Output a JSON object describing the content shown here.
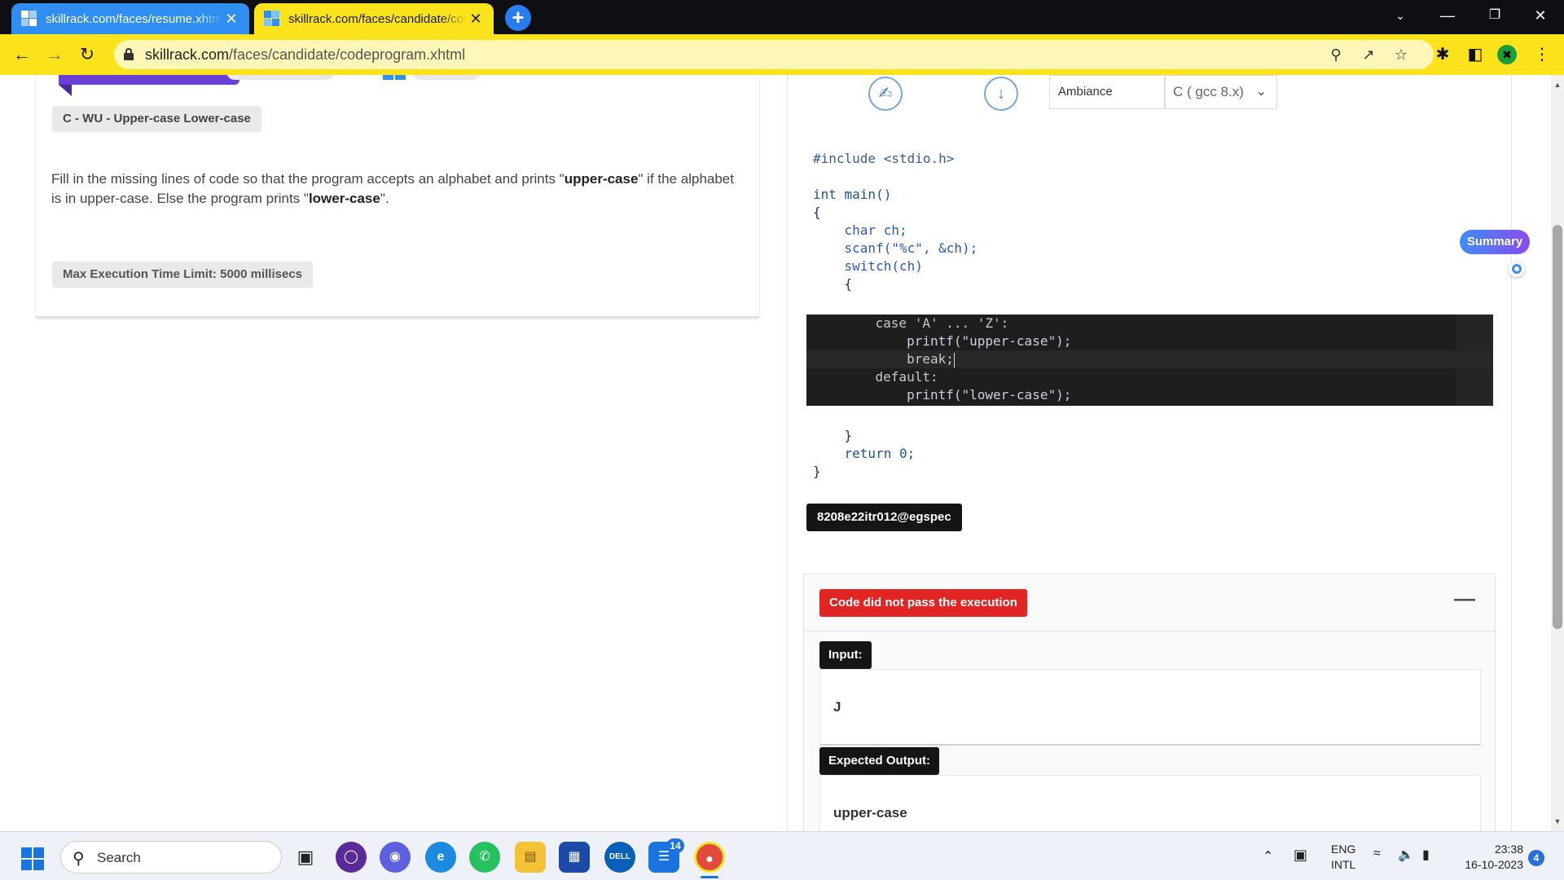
{
  "browser": {
    "tabs": [
      {
        "title": "skillrack.com/faces/resume.xhtml",
        "close": "✕",
        "active": false
      },
      {
        "title": "skillrack.com/faces/candidate/codeprogram.xhtml",
        "close": "✕",
        "active": true
      }
    ],
    "new_tab": "+",
    "url_host": "skillrack.com",
    "url_path": "/faces/candidate/codeprogram.xhtml",
    "colors": {
      "tabbar": "#0d0f12",
      "toolbar": "#fde31c",
      "tab_active": "#fde31c",
      "tab_inactive": "#2f8ef0"
    }
  },
  "problem": {
    "title": "C - WU - Upper-case Lower-case",
    "description_pre": "Fill in the missing lines of code so that the program accepts an alphabet and prints \"",
    "bold1": "upper-case",
    "description_mid": "\" if the alphabet is in upper-case. Else the program prints \"",
    "bold2": "lower-case",
    "description_post": "\".",
    "time_limit": "Max Execution Time Limit: 5000 millisecs"
  },
  "toolbar": {
    "theme_label": "Ambiance",
    "language": "C ( gcc 8.x)"
  },
  "code_before": [
    "#include <stdio.h>",
    "",
    "int main()",
    "{",
    "    char ch;",
    "    scanf(\"%c\", &ch);",
    "    switch(ch)",
    "    {"
  ],
  "editor_lines": [
    "    case 'A' ... 'Z':",
    "        printf(\"upper-case\");",
    "        break;",
    "    default:",
    "        printf(\"lower-case\");"
  ],
  "code_after": [
    "    }",
    "    return 0;",
    "}"
  ],
  "user_id": "8208e22itr012@egspec",
  "result": {
    "status": "Code did not pass the execution",
    "collapse_symbol": "—",
    "input_label": "Input:",
    "input_value": "J",
    "expected_label": "Expected Output:",
    "expected_value": "upper-case",
    "status_color": "#e12424"
  },
  "summary_label": "Summary",
  "taskbar": {
    "search_placeholder": "Search",
    "badge_count": "14",
    "lang_line1": "ENG",
    "lang_line2": "INTL",
    "time": "23:38",
    "date": "16-10-2023",
    "notifications": "4"
  }
}
